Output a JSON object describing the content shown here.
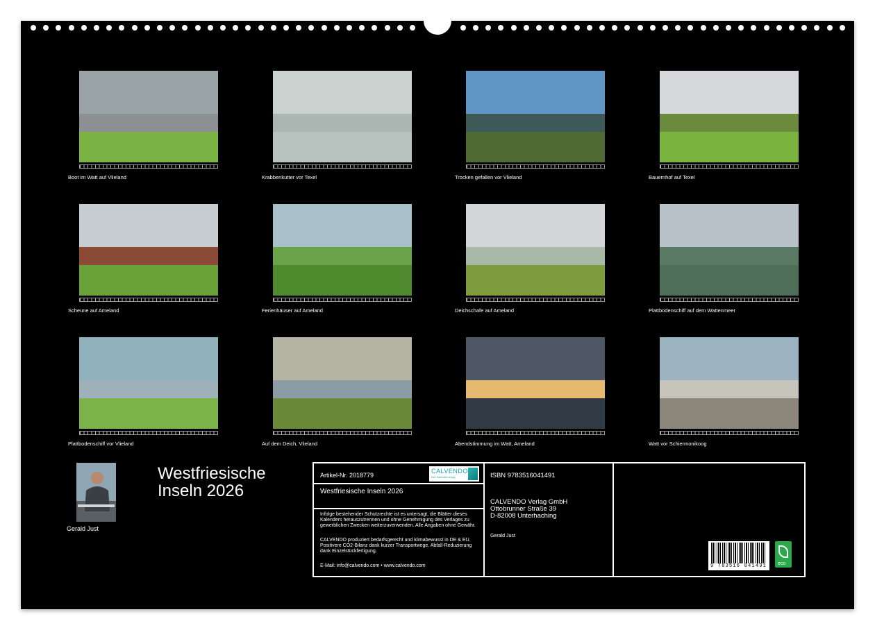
{
  "calendar": {
    "title": "Westfriesische Inseln 2026",
    "title_line1": "Westfriesische",
    "title_line2": "Inseln 2026",
    "author": "Gerald Just"
  },
  "months": [
    {
      "caption": "Boot im Watt auf Vlieland",
      "sky": "#9aa3a6",
      "ground": "#7bb244",
      "water": "#8d9092"
    },
    {
      "caption": "Krabbenkutter vor Texel",
      "sky": "#c9d2cf",
      "ground": "#b9c4c0",
      "water": "#a9b6b2"
    },
    {
      "caption": "Trocken gefallen vor Vlieland",
      "sky": "#5f96c6",
      "ground": "#4f6a35",
      "water": "#3d5a58"
    },
    {
      "caption": "Bauernhof auf Texel",
      "sky": "#d6d8db",
      "ground": "#7ab33e",
      "water": "#6b8a3e"
    },
    {
      "caption": "Scheune auf Ameland",
      "sky": "#c6ccd0",
      "ground": "#6aa23a",
      "water": "#8a4a36"
    },
    {
      "caption": "Ferienhäuser auf Ameland",
      "sky": "#aac0c9",
      "ground": "#4f8a2e",
      "water": "#6aa34a"
    },
    {
      "caption": "Deichschafe auf Ameland",
      "sky": "#d2d6d8",
      "ground": "#7e9b3e",
      "water": "#a9b9a8"
    },
    {
      "caption": "Plattbodenschiff auf dem Wattenmeer",
      "sky": "#b8c2c8",
      "ground": "#4f6e5a",
      "water": "#5a7a66"
    },
    {
      "caption": "Plattbodenschiff vor Vlieland",
      "sky": "#8fb2bd",
      "ground": "#7bb24a",
      "water": "#9fb1b8"
    },
    {
      "caption": "Auf dem Deich, Vlieland",
      "sky": "#b6b4a5",
      "ground": "#6a8a3a",
      "water": "#8c9ca4"
    },
    {
      "caption": "Abendstimmung im Watt, Ameland",
      "sky": "#4d5763",
      "ground": "#2f3a44",
      "water": "#e6b870"
    },
    {
      "caption": "Watt vor Schiermonikoog",
      "sky": "#9bb3c0",
      "ground": "#8c857a",
      "water": "#c7c4bc"
    }
  ],
  "info": {
    "article": "Artikel-Nr. 2018779",
    "logo_text": "CALVENDO",
    "logo_sub": "Der Kalenderverlag",
    "title": "Westfriesische Inseln 2026",
    "legal1": "Infolge bestehender Schutzrechte ist es untersagt, die Blätter dieses Kalenders herauszutrennen und ohne Genehmigung des Verlages zu gewerblichen Zwecken weiterzuverwenden. Alle Angaben ohne Gewähr.",
    "legal2": "CALVENDO produziert bedarfsgerecht und klimabewusst in DE & EU. Positivere CO2-Bilanz dank kurzer Transportwege. Abfall-Reduzierung dank Einzelstückfertigung.",
    "contact": "E-Mail: info@calvendo.com • www.calvendo.com",
    "isbn": "ISBN 9783516041491",
    "publisher1": "CALVENDO Verlag GmbH",
    "publisher2": "Ottobrunner Straße 39",
    "publisher3": "D-82008 Unterhaching",
    "author": "Gerald Just",
    "barcode_number": "9 783516 041491",
    "eco_label": "eco"
  }
}
